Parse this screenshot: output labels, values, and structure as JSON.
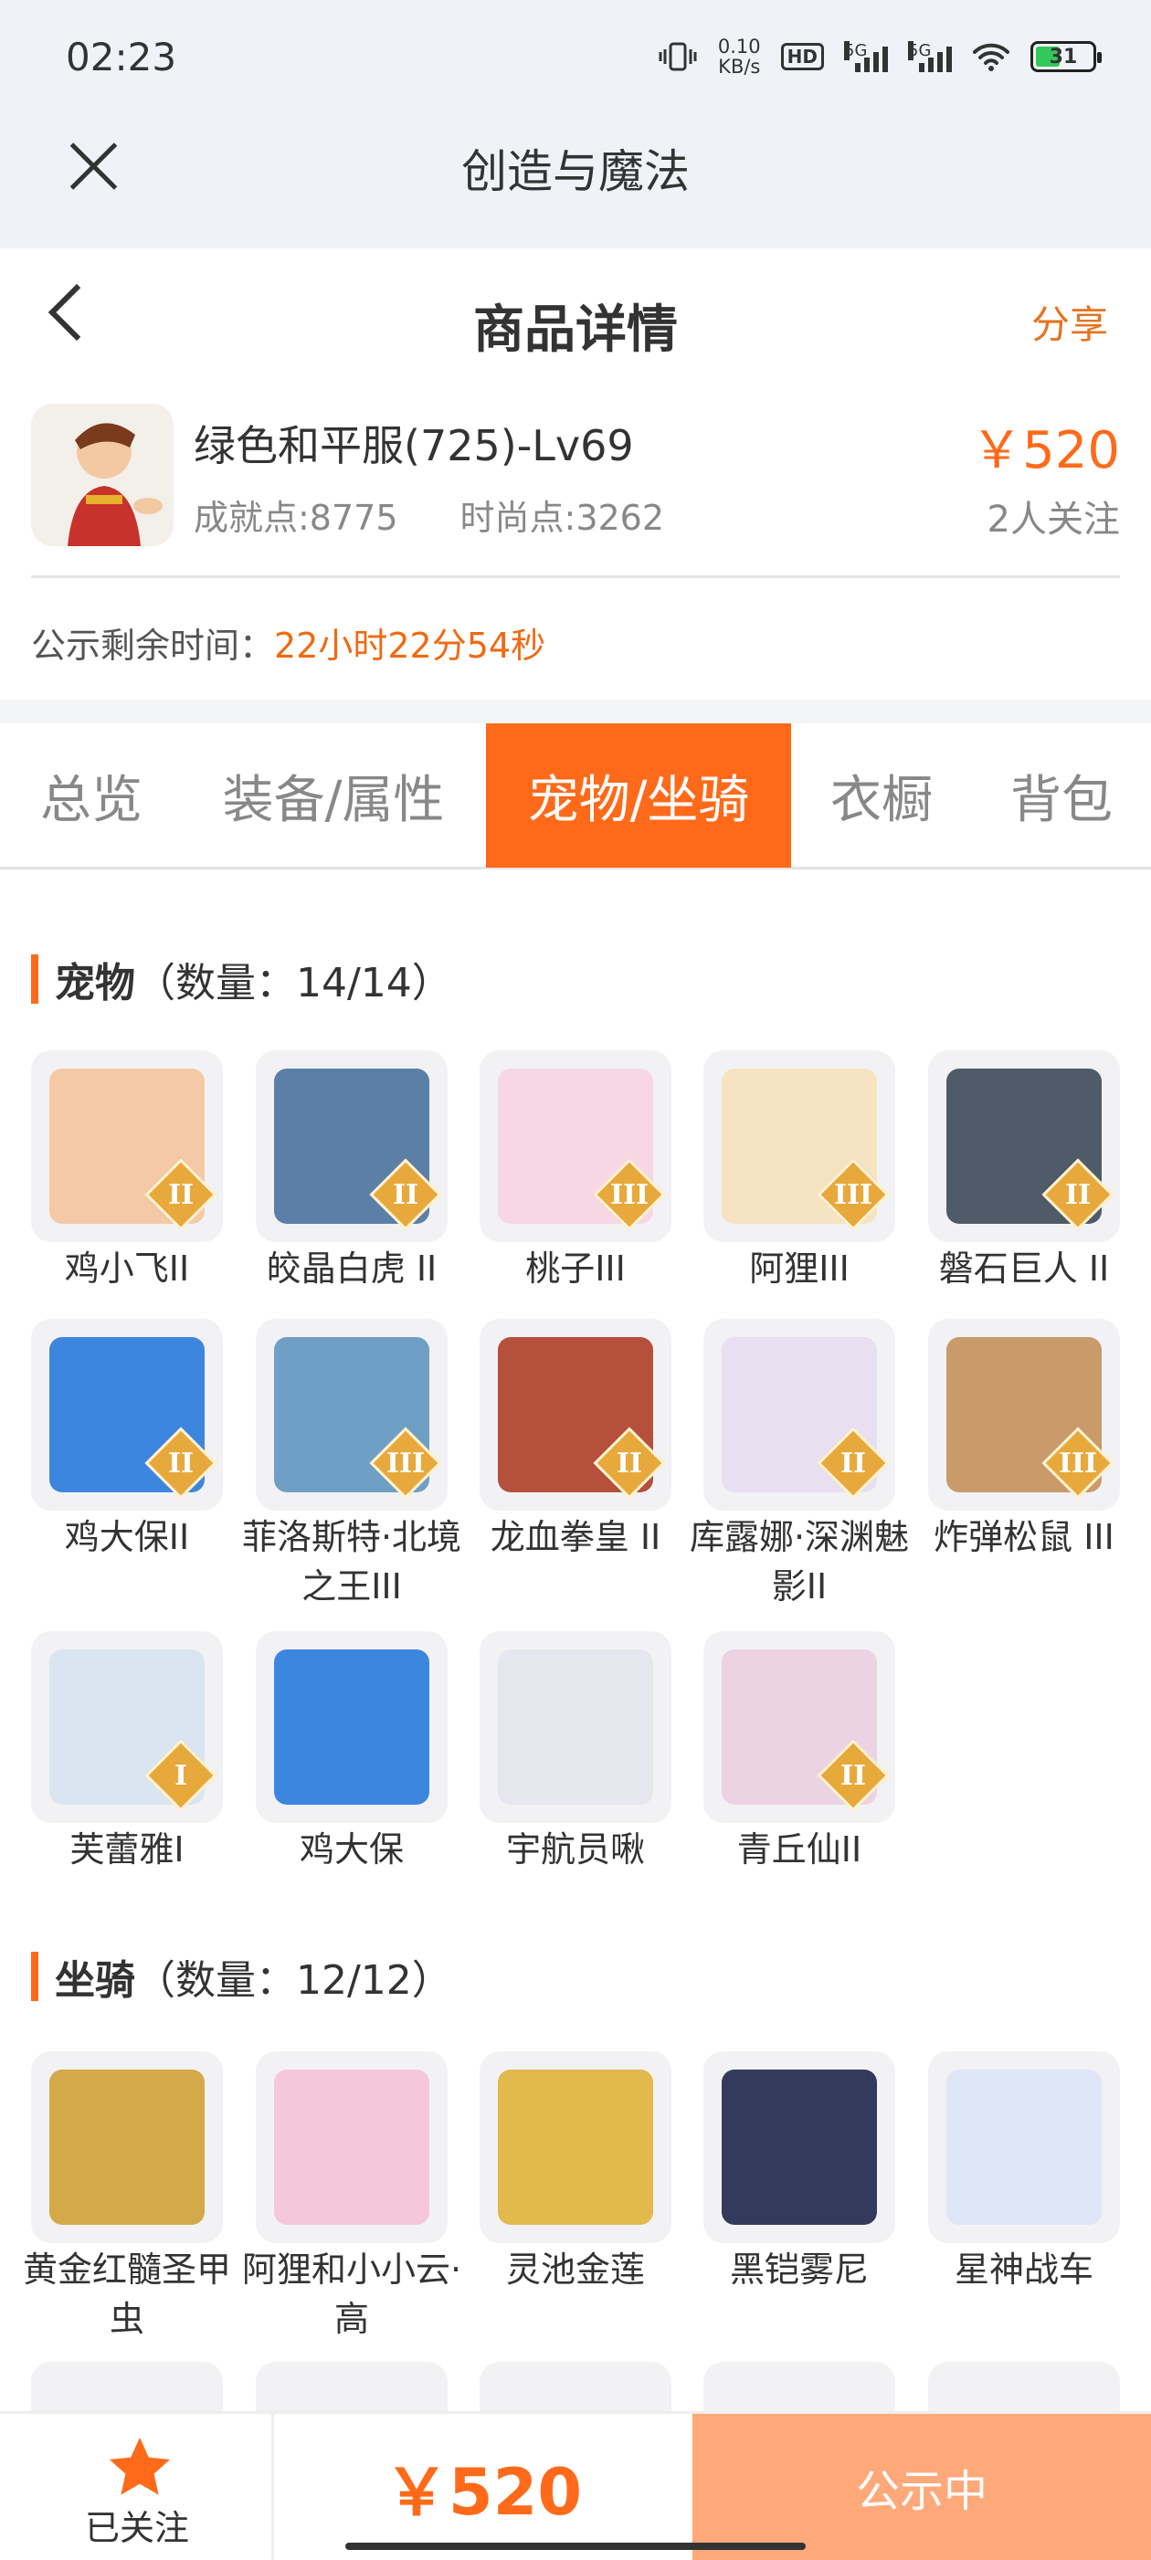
{
  "status_bar": {
    "time": "02:23",
    "net_speed_value": "0.10",
    "net_speed_unit": "KB/s",
    "hd_label": "HD",
    "sig1": "5G",
    "sig2": "5G",
    "battery": "31"
  },
  "app_header": {
    "close_icon": "close-icon",
    "title": "创造与魔法"
  },
  "page_header": {
    "title": "商品详情",
    "share_label": "分享"
  },
  "product": {
    "name": "绿色和平服(725)-Lv69",
    "achievement": "成就点:8775",
    "fashion": "时尚点:3262",
    "price": "￥520",
    "followers": "2人关注"
  },
  "notice": {
    "label": "公示剩余时间：",
    "remaining": "22小时22分54秒"
  },
  "tabs": [
    "总览",
    "装备/属性",
    "宠物/坐骑",
    "衣橱",
    "背包"
  ],
  "active_tab": 2,
  "pets_section": {
    "title": "宠物",
    "count": "（数量：14/14）"
  },
  "pets": [
    {
      "name": "鸡小飞II",
      "level": "II",
      "bg": "#f4c9a6"
    },
    {
      "name": "皎晶白虎 II",
      "level": "II",
      "bg": "#5c7fa8"
    },
    {
      "name": "桃子III",
      "level": "III",
      "bg": "#f7d7e4"
    },
    {
      "name": "阿狸III",
      "level": "III",
      "bg": "#f6e3c2"
    },
    {
      "name": "磐石巨人 II",
      "level": "II",
      "bg": "#4f5b68"
    },
    {
      "name": "鸡大保II",
      "level": "II",
      "bg": "#3d86e0"
    },
    {
      "name": "菲洛斯特·北境之王III",
      "level": "III",
      "bg": "#6f9fc4"
    },
    {
      "name": "龙血拳皇 II",
      "level": "II",
      "bg": "#b4503c"
    },
    {
      "name": "库露娜·深渊魅影II",
      "level": "II",
      "bg": "#e8e0f0"
    },
    {
      "name": "炸弹松鼠 III",
      "level": "III",
      "bg": "#c99b6a"
    },
    {
      "name": "芙蕾雅I",
      "level": "I",
      "bg": "#d9e6f2"
    },
    {
      "name": "鸡大保",
      "level": "",
      "bg": "#3d86e0"
    },
    {
      "name": "宇航员啾",
      "level": "",
      "bg": "#e6e7ee"
    },
    {
      "name": "青丘仙II",
      "level": "II",
      "bg": "#ecd3e4"
    }
  ],
  "mounts_section": {
    "title": "坐骑",
    "count": "（数量：12/12）"
  },
  "mounts": [
    {
      "name": "黄金红髓圣甲虫",
      "level": "",
      "bg": "#d4a94a"
    },
    {
      "name": "阿狸和小小云·高",
      "level": "",
      "bg": "#f4c8d8"
    },
    {
      "name": "灵池金莲",
      "level": "",
      "bg": "#e2b94c"
    },
    {
      "name": "黑铠雾尼",
      "level": "",
      "bg": "#333a5c"
    },
    {
      "name": "星神战车",
      "level": "",
      "bg": "#dfe6f5"
    }
  ],
  "bottom_bar": {
    "follow_label": "已关注",
    "price": "￥520",
    "status_label": "公示中"
  },
  "colors": {
    "accent": "#ff6a1a",
    "status_button": "#ffa87a"
  }
}
